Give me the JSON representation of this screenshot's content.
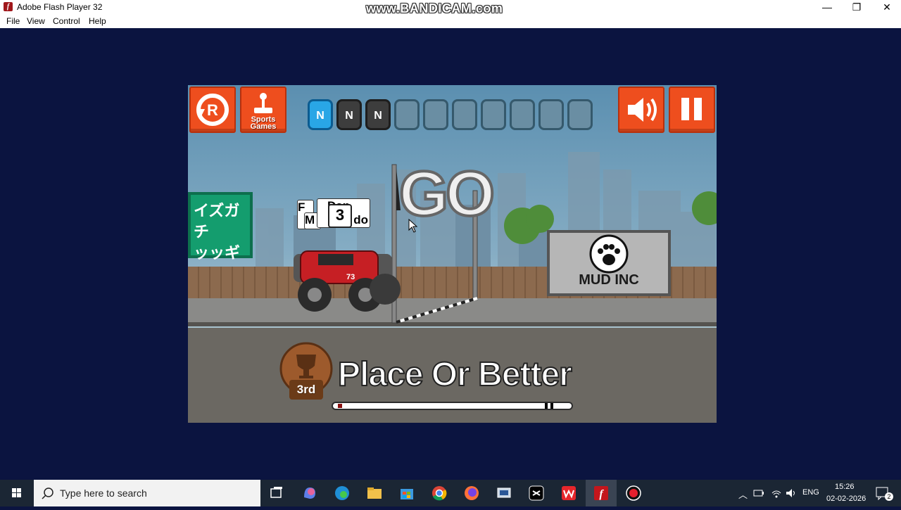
{
  "window": {
    "title": "Adobe Flash Player 32",
    "watermark": "www.BANDICAM.com",
    "controls": {
      "minimize": "—",
      "restore": "❐",
      "close": "✕"
    }
  },
  "menu": [
    "File",
    "View",
    "Control",
    "Help"
  ],
  "game": {
    "buttons": {
      "restart_letter": "R",
      "sports_games_line1": "Sports",
      "sports_games_line2": "Games"
    },
    "nitro_slots": [
      "N",
      "N",
      "N",
      "",
      "",
      "",
      "",
      "",
      "",
      ""
    ],
    "go_text": "GO",
    "billboard_left_text": "イズガチ\nッッギ",
    "billboard_right_text": "MUD INC",
    "nametags": [
      "F",
      "M",
      "Dan",
      "M",
      "do"
    ],
    "position_number": "3",
    "car_number": "73",
    "objective": {
      "trophy_label": "3rd",
      "text": "Place Or Better",
      "race_progress": 0.0
    },
    "colors": {
      "button": "#ee4e1e",
      "nitro_active": "#29a6e6"
    }
  },
  "taskbar": {
    "search_placeholder": "Type here to search",
    "language": "ENG",
    "time": "15:26",
    "date": "02-02-2026",
    "notifications": "2",
    "apps": [
      "task-view",
      "copilot",
      "edge",
      "file-explorer",
      "store",
      "chrome",
      "firefox",
      "network-app",
      "capcut",
      "wps",
      "flash",
      "bandicam-record"
    ]
  }
}
